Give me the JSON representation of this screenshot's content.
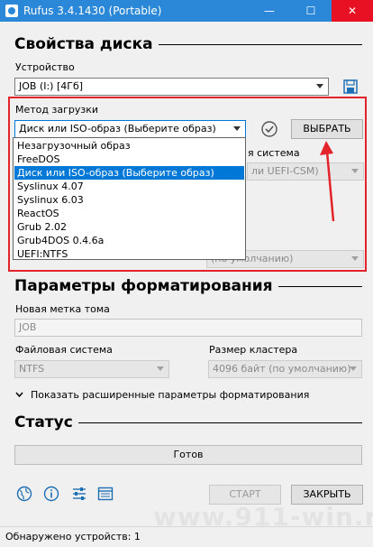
{
  "window": {
    "title": "Rufus 3.4.1430 (Portable)",
    "minimize_glyph": "—",
    "maximize_glyph": "☐",
    "close_glyph": "✕"
  },
  "drive_properties": {
    "heading": "Свойства диска",
    "device_label": "Устройство",
    "device_value": "JOB (I:) [4Гб]",
    "boot_method_label": "Метод загрузки",
    "boot_method_value": "Диск или ISO-образ (Выберите образ)",
    "select_button": "ВЫБРАТЬ",
    "target_system_label_partial": "я система",
    "target_system_value_partial": "ли UEFI-CSM)",
    "cluster_default_partial": "(по умолчанию)",
    "boot_menu_options": [
      "Незагрузочный образ",
      "FreeDOS",
      "Диск или ISO-образ (Выберите образ)",
      "Syslinux 4.07",
      "Syslinux 6.03",
      "ReactOS",
      "Grub 2.02",
      "Grub4DOS 0.4.6a",
      "UEFI:NTFS"
    ],
    "selected_option_index": 2
  },
  "format_options": {
    "heading": "Параметры форматирования",
    "volume_label_label": "Новая метка тома",
    "volume_label_value": "JOB",
    "filesystem_label": "Файловая система",
    "filesystem_value": "NTFS",
    "cluster_label": "Размер кластера",
    "cluster_value": "4096 байт (по умолчанию)",
    "advanced_toggle": "Показать расширенные параметры форматирования"
  },
  "status": {
    "heading": "Статус",
    "progress_text": "Готов",
    "start_button": "СТАРТ",
    "close_button": "ЗАКРЫТЬ"
  },
  "statusbar": {
    "text": "Обнаружено устройств: 1"
  },
  "watermark": "www.911-win.ru",
  "colors": {
    "titlebar": "#2b88d8",
    "highlight": "#0078d7",
    "annotation": "#e3242b"
  }
}
